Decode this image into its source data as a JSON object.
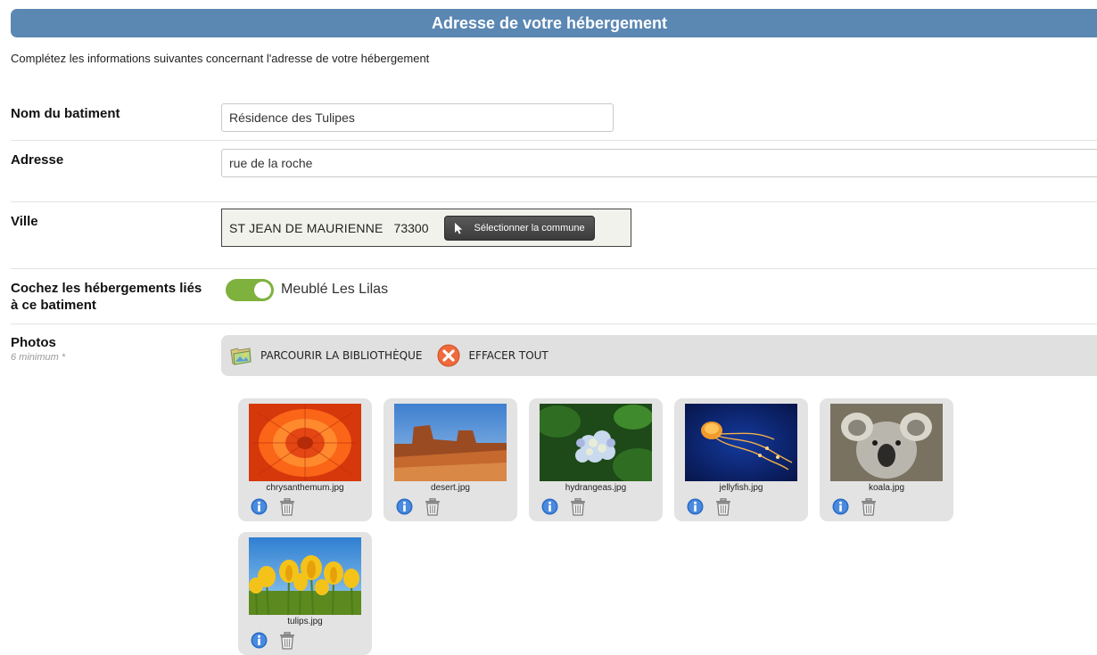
{
  "header": {
    "title": "Adresse de votre hébergement"
  },
  "intro": "Complétez les informations suivantes concernant l'adresse de votre hébergement",
  "form": {
    "building_name": {
      "label": "Nom du batiment",
      "value": "Résidence des Tulipes"
    },
    "address": {
      "label": "Adresse",
      "value": "rue de la roche"
    },
    "city": {
      "label": "Ville",
      "name": "ST JEAN DE MAURIENNE",
      "postal_code": "73300",
      "select_button": "Sélectionner la commune"
    },
    "linked": {
      "label": "Cochez les hébergements liés à ce batiment",
      "toggle_on": true,
      "toggle_label": "Meublé Les Lilas",
      "toggle_color": "#7fb13e"
    },
    "photos": {
      "label": "Photos",
      "hint": "6 minimum *",
      "browse_label": "PARCOURIR LA BIBLIOTHÈQUE",
      "clear_label": "EFFACER TOUT",
      "files": [
        {
          "name": "chrysanthemum.jpg"
        },
        {
          "name": "desert.jpg"
        },
        {
          "name": "hydrangeas.jpg"
        },
        {
          "name": "jellyfish.jpg"
        },
        {
          "name": "koala.jpg"
        },
        {
          "name": "tulips.jpg"
        }
      ]
    }
  },
  "colors": {
    "header_bg": "#5b87b3",
    "toolbar_bg": "#e0e0e0",
    "card_bg": "#e3e3e3",
    "info_blue": "#2b6cc4"
  }
}
